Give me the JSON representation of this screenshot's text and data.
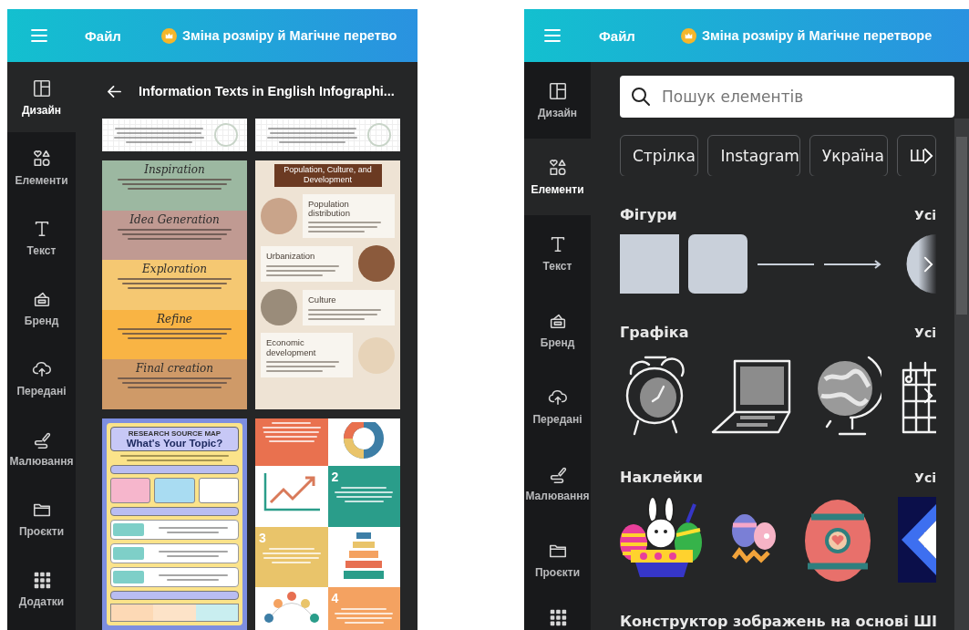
{
  "screens": [
    {
      "kind": "templates",
      "top_bar": {
        "file_menu": "Файл",
        "promo": "Зміна розміру й Магічне перетво"
      },
      "sidebar": [
        {
          "kind": "design",
          "label": "Дизайн",
          "selected": true
        },
        {
          "kind": "elements",
          "label": "Елементи",
          "selected": false
        },
        {
          "kind": "text",
          "label": "Текст",
          "selected": false
        },
        {
          "kind": "brand",
          "label": "Бренд",
          "selected": false
        },
        {
          "kind": "uploads",
          "label": "Передані",
          "selected": false
        },
        {
          "kind": "draw",
          "label": "Малювання",
          "selected": false
        },
        {
          "kind": "projects",
          "label": "Проєкти",
          "selected": false
        },
        {
          "kind": "apps",
          "label": "Додатки",
          "selected": false
        }
      ],
      "panel": {
        "title": "Information Texts in English Infographi...",
        "templates": [
          {
            "kind": "document"
          },
          {
            "kind": "document"
          },
          {
            "kind": "sections",
            "headings": [
              "Inspiration",
              "Idea Generation",
              "Exploration",
              "Refine",
              "Final creation"
            ]
          },
          {
            "kind": "topics",
            "title": "Population, Culture, and Development",
            "headings": [
              "Population distribution",
              "Urbanization",
              "Culture",
              "Economic development"
            ]
          },
          {
            "kind": "worksheet",
            "eyebrow": "RESEARCH SOURCE MAP",
            "title": "What's Your Topic?"
          },
          {
            "kind": "grid",
            "numbers": [
              "2",
              "3",
              "4"
            ]
          }
        ]
      }
    },
    {
      "kind": "elements",
      "top_bar": {
        "file_menu": "Файл",
        "promo": "Зміна розміру й Магічне перетворе"
      },
      "sidebar": [
        {
          "kind": "design",
          "label": "Дизайн",
          "selected": false
        },
        {
          "kind": "elements",
          "label": "Елементи",
          "selected": true
        },
        {
          "kind": "text",
          "label": "Текст",
          "selected": false
        },
        {
          "kind": "brand",
          "label": "Бренд",
          "selected": false
        },
        {
          "kind": "uploads",
          "label": "Передані",
          "selected": false
        },
        {
          "kind": "draw",
          "label": "Малювання",
          "selected": false
        },
        {
          "kind": "projects",
          "label": "Проєкти",
          "selected": false
        },
        {
          "kind": "apps",
          "selected": false
        }
      ],
      "panel": {
        "search": {
          "placeholder": "Пошук елементів"
        },
        "chips": [
          "Стрілка",
          "Instagram",
          "Україна",
          "Ш"
        ],
        "sections": [
          {
            "kind": "shapes",
            "title": "Фігури",
            "action": "Усі"
          },
          {
            "kind": "graphics",
            "title": "Графіка",
            "action": "Усі"
          },
          {
            "kind": "stickers",
            "title": "Наклейки",
            "action": "Усі"
          },
          {
            "kind": "generator",
            "title": "Конструктор зображень на основі ШІ"
          }
        ]
      }
    }
  ]
}
